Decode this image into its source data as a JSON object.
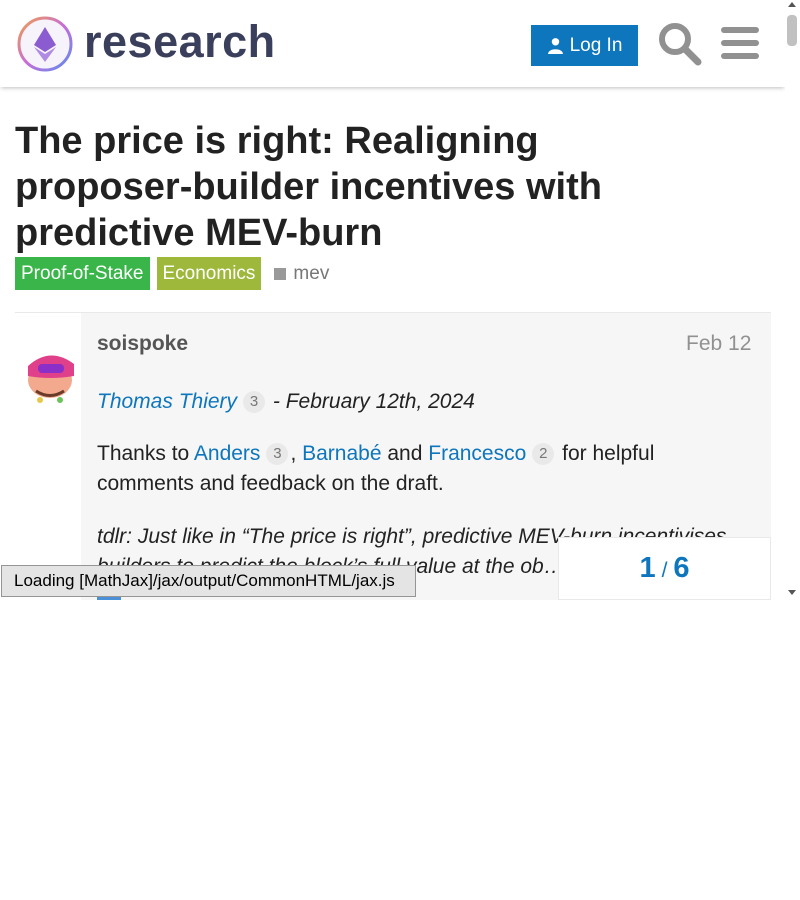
{
  "header": {
    "logo_text": "research",
    "login_label": "Log In",
    "search_icon": "search-icon",
    "menu_icon": "hamburger-menu-icon"
  },
  "topic": {
    "title": "The price is right: Realigning proposer-builder incentives with predictive MEV-burn",
    "categories": [
      {
        "label": "Proof-of-Stake",
        "color": "#3ab54a"
      },
      {
        "label": "Economics",
        "color": "#9eb83b"
      }
    ],
    "tags": [
      "mev"
    ]
  },
  "post": {
    "username": "soispoke",
    "date": "Feb 12",
    "author_link": "Thomas Thiery",
    "author_badge": "3",
    "date_text": " - February 12th, 2024",
    "thanks_prefix": "Thanks to ",
    "thanks_1": "Anders",
    "thanks_1_badge": "3",
    "comma": ",",
    "thanks_2": "Barnabé",
    "and": " and ",
    "thanks_3": "Francesco",
    "thanks_3_badge": "2",
    "thanks_suffix": " for helpful comments and feedback on the draft.",
    "tldr": "tdlr: Just like in “The price is right”, predictive MEV-burn incentivises builders to predict the block’s full value at the ob… without going over"
  },
  "mathjax_status": "Loading [MathJax]/jax/output/CommonHTML/jax.js",
  "progress": {
    "current": "1",
    "separator": "/",
    "total": "6"
  },
  "colors": {
    "link": "#0e76bd",
    "proof_of_stake": "#3ab54a",
    "economics": "#9eb83b"
  }
}
